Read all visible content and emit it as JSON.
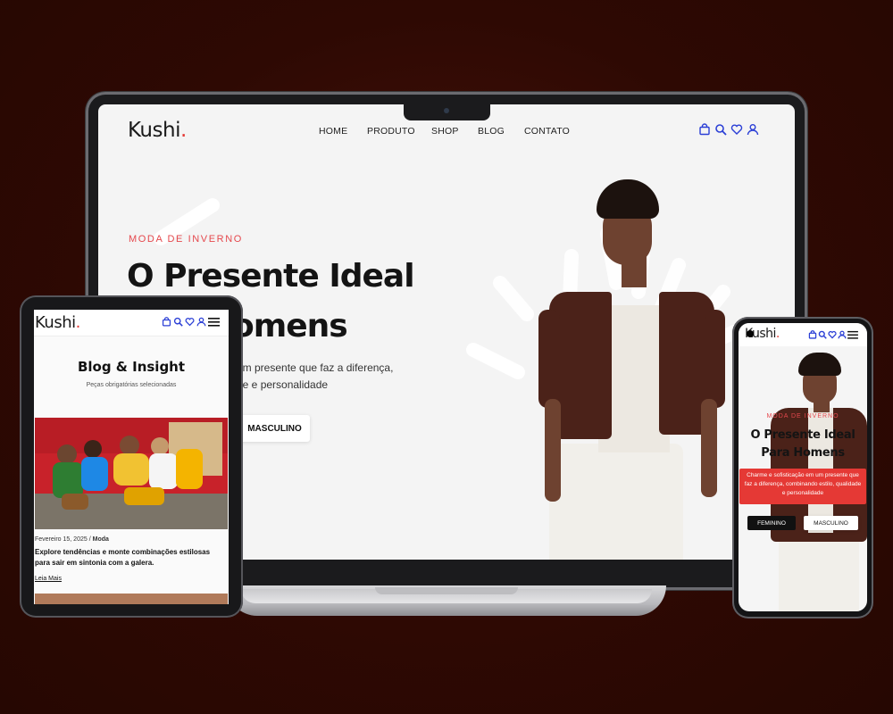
{
  "brand": {
    "name": "Kushi",
    "dot": "."
  },
  "laptop": {
    "nav": [
      "HOME",
      "PRODUTO",
      "SHOP",
      "BLOG",
      "CONTATO"
    ],
    "icons": [
      "bag-icon",
      "search-icon",
      "heart-icon",
      "user-icon"
    ],
    "hero": {
      "label": "MODA DE INVERNO",
      "title_line1": "O Presente Ideal",
      "title_line2": "omens",
      "text_line1": "um presente que faz a diferença,",
      "text_line2": "de e personalidade",
      "button": "MASCULINO"
    }
  },
  "tablet": {
    "title": "Blog & Insight",
    "subtitle": "Peças obrigatórias selecionadas",
    "post": {
      "date": "Fevereiro 15, 2025",
      "separator": " / ",
      "category": "Moda",
      "headline": "Explore tendências e monte combinações estilosas para sair em sintonia com a galera.",
      "link": "Leia Mais"
    }
  },
  "phone": {
    "label": "MODA DE INVERNO",
    "title_line1": "O Presente Ideal",
    "title_line2": "Para Homens",
    "text": "Charme e sofisticação em um presente que faz a diferença, combinando estilo, qualidade e personalidade",
    "btn_feminino": "FEMININO",
    "btn_masculino": "MASCULINO"
  },
  "colors": {
    "background": "#2e0903",
    "accent": "#e5484d",
    "icon_blue": "#2b3fd6",
    "text_dark": "#141414"
  }
}
